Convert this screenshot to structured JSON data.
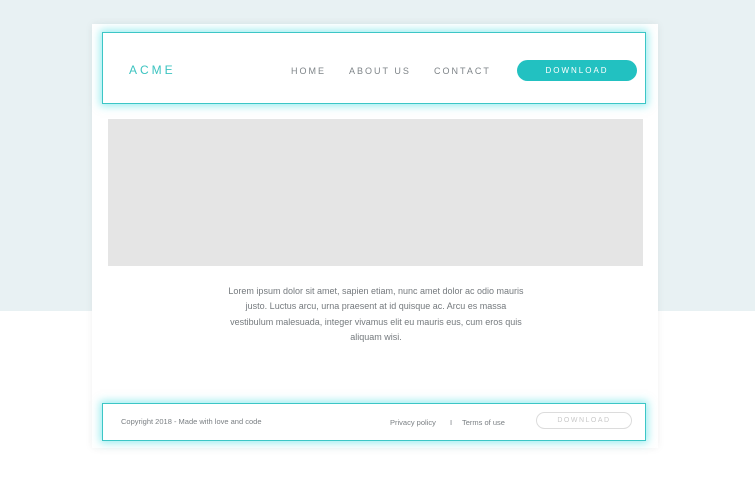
{
  "header": {
    "logo": "ACME",
    "nav": {
      "home": "HOME",
      "about": "ABOUT US",
      "contact": "CONTACT"
    },
    "download_label": "DOWNLOAD"
  },
  "main": {
    "body_text": "Lorem ipsum dolor sit amet, sapien etiam, nunc amet dolor ac odio mauris justo. Luctus arcu, urna praesent at id quisque ac. Arcu es massa vestibulum malesuada, integer vivamus elit eu mauris eus, cum eros quis aliquam wisi."
  },
  "footer": {
    "copyright": "Copyright 2018 - Made with love and code",
    "privacy": "Privacy policy",
    "separator": "I",
    "terms": "Terms of use",
    "download_label": "DOWNLOAD"
  },
  "colors": {
    "accent": "#22c1c1",
    "page_top_background": "#e8f1f3",
    "image_placeholder": "#e5e5e5"
  }
}
